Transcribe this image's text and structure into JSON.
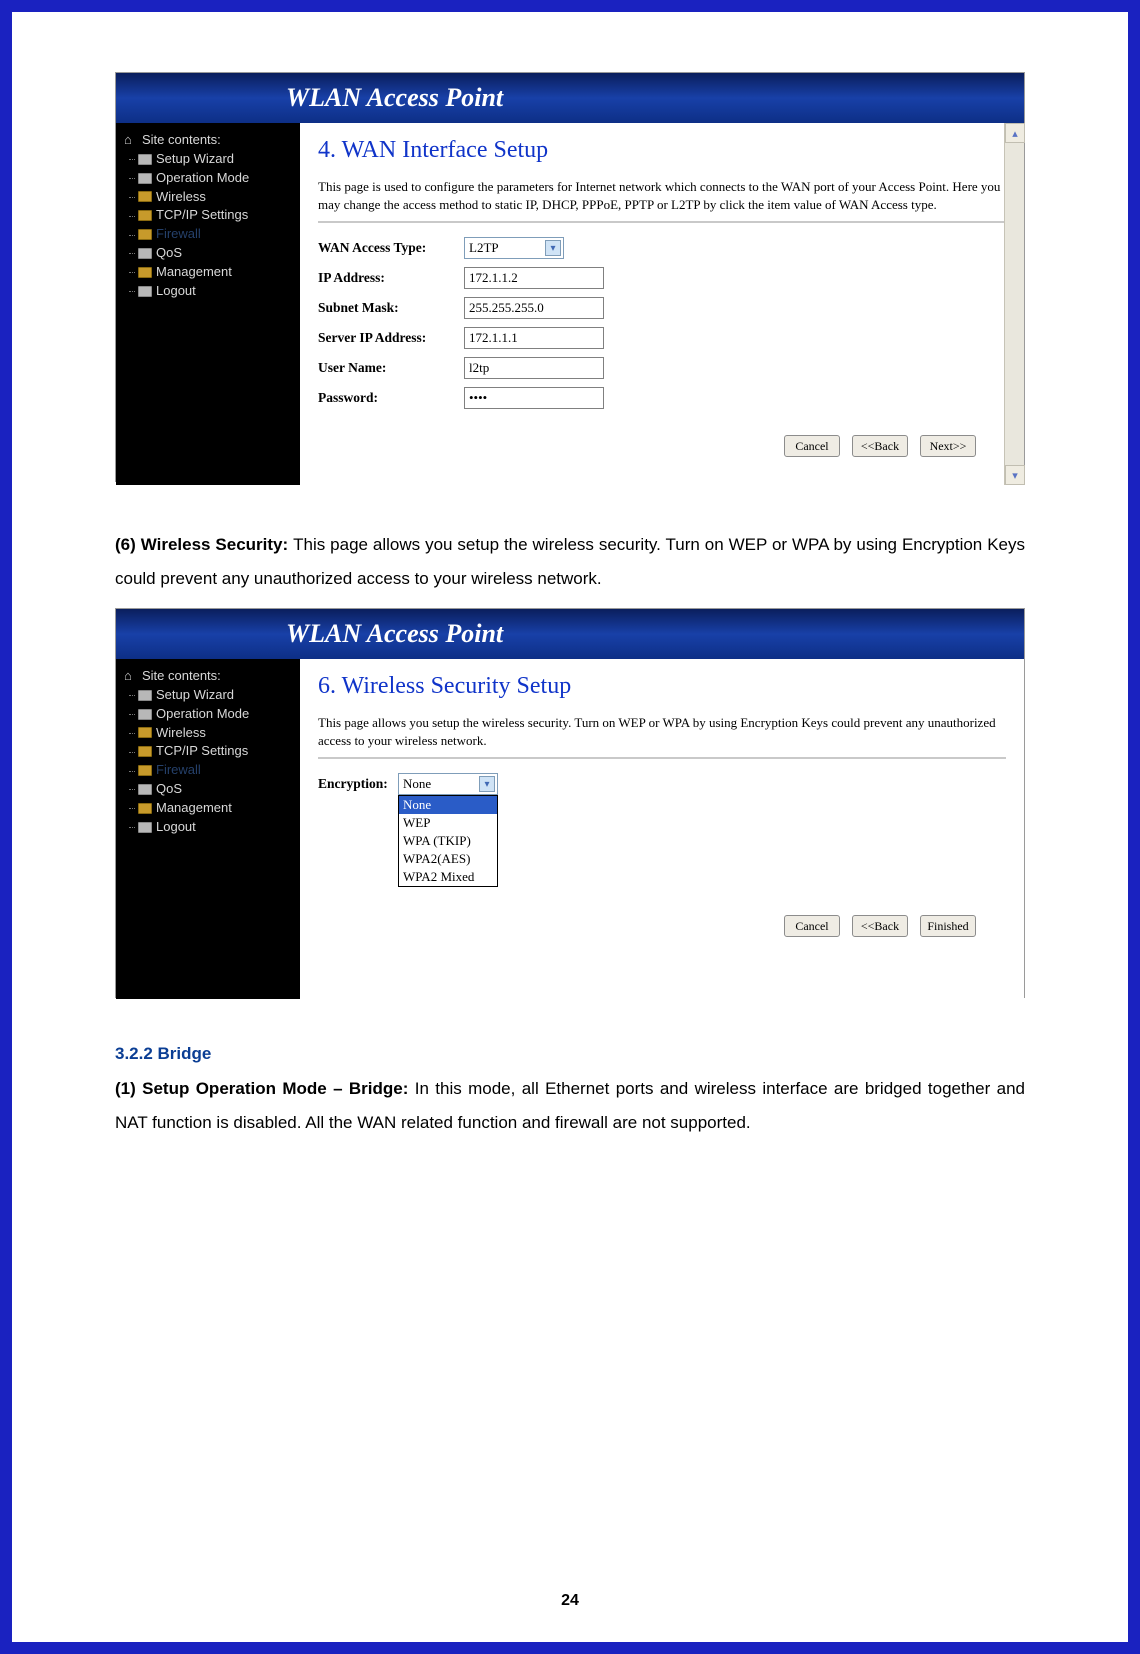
{
  "page_number": "24",
  "banner_title": "WLAN Access Point",
  "nav": {
    "root": "Site contents:",
    "items": [
      "Setup Wizard",
      "Operation Mode",
      "Wireless",
      "TCP/IP Settings",
      "Firewall",
      "QoS",
      "Management",
      "Logout"
    ]
  },
  "shot1": {
    "title": "4. WAN Interface Setup",
    "desc": "This page is used to configure the parameters for Internet network which connects to the WAN port of your Access Point. Here you may change the access method to static IP, DHCP, PPPoE, PPTP or L2TP by click the item value of WAN Access type.",
    "labels": {
      "wan_type": "WAN Access Type:",
      "ip": "IP Address:",
      "mask": "Subnet Mask:",
      "server_ip": "Server IP Address:",
      "user": "User Name:",
      "pass": "Password:"
    },
    "values": {
      "wan_type": "L2TP",
      "ip": "172.1.1.2",
      "mask": "255.255.255.0",
      "server_ip": "172.1.1.1",
      "user": "l2tp",
      "pass": "●●●●"
    },
    "buttons": {
      "cancel": "Cancel",
      "back": "<<Back",
      "next": "Next>>"
    }
  },
  "para6": {
    "lead": "(6) Wireless Security: ",
    "body": "This page allows you setup the wireless security. Turn on WEP or WPA by using Encryption Keys could prevent any unauthorized access to your wireless network."
  },
  "shot2": {
    "title": "6. Wireless Security Setup",
    "desc": "This page allows you setup the wireless security. Turn on WEP or WPA by using Encryption Keys could prevent any unauthorized access to your wireless network.",
    "enc_label": "Encryption:",
    "enc_value": "None",
    "options": [
      "None",
      "WEP",
      "WPA (TKIP)",
      "WPA2(AES)",
      "WPA2 Mixed"
    ],
    "buttons": {
      "cancel": "Cancel",
      "back": "<<Back",
      "finished": "Finished"
    }
  },
  "bridge": {
    "head": "3.2.2 Bridge",
    "lead": "(1) Setup Operation Mode – Bridge: ",
    "body": "In this mode, all Ethernet ports and wireless interface are bridged together and NAT function is disabled. All the WAN related function and firewall are not supported."
  }
}
